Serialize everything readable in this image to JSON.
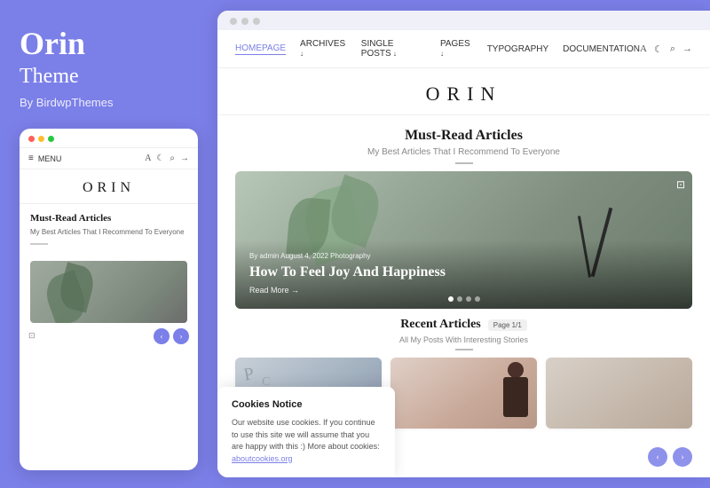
{
  "left": {
    "title": "Orin",
    "subtitle": "Theme",
    "by": "By BirdwpThemes",
    "mini": {
      "nav_label": "MENU",
      "logo": "ORIN",
      "section_title": "Must-Read Articles",
      "section_desc": "My Best Articles That I Recommend To Everyone"
    }
  },
  "right": {
    "browser_dots": [
      "gray",
      "gray",
      "gray"
    ],
    "nav": {
      "items": [
        "HOMEPAGE",
        "ARCHIVES",
        "SINGLE POSTS",
        "PAGES",
        "TYPOGRAPHY",
        "DOCUMENTATION"
      ],
      "active": "HOMEPAGE",
      "icons": [
        "A",
        "☾",
        "🔍",
        "→"
      ]
    },
    "logo": "ORIN",
    "hero_section": {
      "title": "Must-Read Articles",
      "subtitle": "My Best Articles That I Recommend To Everyone"
    },
    "featured": {
      "meta": "By admin    August 4, 2022    Photography",
      "headline": "How To Feel Joy And Happiness",
      "readmore": "Read More →"
    },
    "recent": {
      "title": "Recent Articles",
      "subtitle": "All My Posts With Interesting Stories",
      "page_badge": "Page 1/1"
    },
    "cookie": {
      "title": "Cookies Notice",
      "text": "Our website use cookies. If you continue to use this site we will assume that you are happy with this :) More about cookies:",
      "link": "aboutcookies.org"
    }
  }
}
